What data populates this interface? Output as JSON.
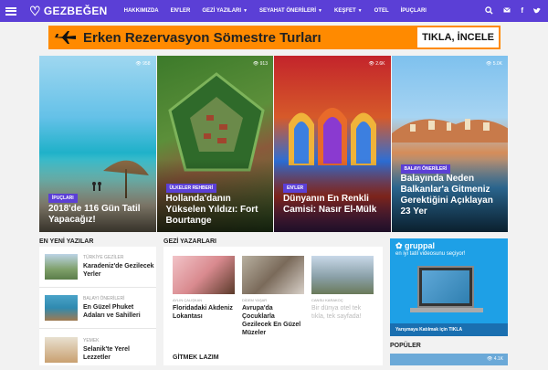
{
  "nav": {
    "logo": "GEZBEĞEN",
    "menu": [
      {
        "label": "HAKKIMIZDA",
        "dropdown": false
      },
      {
        "label": "EN'LER",
        "dropdown": false
      },
      {
        "label": "GEZİ YAZILARI",
        "dropdown": true
      },
      {
        "label": "SEYAHAT ÖNERİLERİ",
        "dropdown": true
      },
      {
        "label": "KEŞFET",
        "dropdown": true
      },
      {
        "label": "OTEL",
        "dropdown": false
      },
      {
        "label": "İPUÇLARI",
        "dropdown": false
      }
    ],
    "icons": [
      "search-icon",
      "mail-icon",
      "facebook-icon",
      "twitter-icon"
    ],
    "color": "#5b3fd6"
  },
  "banner": {
    "text": "Erken Rezervasyon Sömestre Turları",
    "cta": "TIKLA, İNCELE",
    "color": "#ff8a00"
  },
  "cards": [
    {
      "views": "958",
      "category": "İPUÇLARI",
      "title": "2018'de 116 Gün Tatil Yapacağız!"
    },
    {
      "views": "913",
      "category": "ÜLKELER REHBERİ",
      "title": "Hollanda'danın Yükselen Yıldızı: Fort Bourtange"
    },
    {
      "views": "2.6K",
      "category": "EN'LER",
      "title": "Dünyanın En Renkli Camisi: Nasır El-Mülk"
    },
    {
      "views": "5.0K",
      "category": "BALAYI ÖNERİLERİ",
      "title": "Balayında Neden Balkanlar'a Gitmeniz Gerektiğini Açıklayan 23 Yer"
    }
  ],
  "latest": {
    "heading": "EN YENİ YAZILAR",
    "items": [
      {
        "category": "TÜRKİYE GEZİLER",
        "title": "Karadeniz'de Gezilecek Yerler"
      },
      {
        "category": "BALAYI ÖNERİLERİ",
        "title": "En Güzel Phuket Adaları ve Sahilleri"
      },
      {
        "category": "YEMEK",
        "title": "Selanik'te Yerel Lezzetler"
      }
    ]
  },
  "writers": {
    "heading": "GEZİ YAZARLARI",
    "items": [
      {
        "author": "AYLIN ÇALIŞKAN",
        "title": "Floridadaki Akdeniz Lokantası",
        "faded": false
      },
      {
        "author": "DİDEM YAŞAR",
        "title": "Avrupa'da Çocuklarla Gezilecek En Güzel Müzeler",
        "faded": false
      },
      {
        "author": "CANSU KARAKOÇ",
        "title": "Bir dünya otel tek tıkla, tek sayfada!",
        "faded": true
      }
    ],
    "next_heading": "GİTMEK LAZIM"
  },
  "ad": {
    "brand": "✿ gruppal",
    "subtitle": "en iyi tatil videosunu seçiyor!",
    "footer": "Yarışmaya Katılmak için TIKLA"
  },
  "popular": {
    "heading": "POPÜLER",
    "views": "4.1K"
  }
}
